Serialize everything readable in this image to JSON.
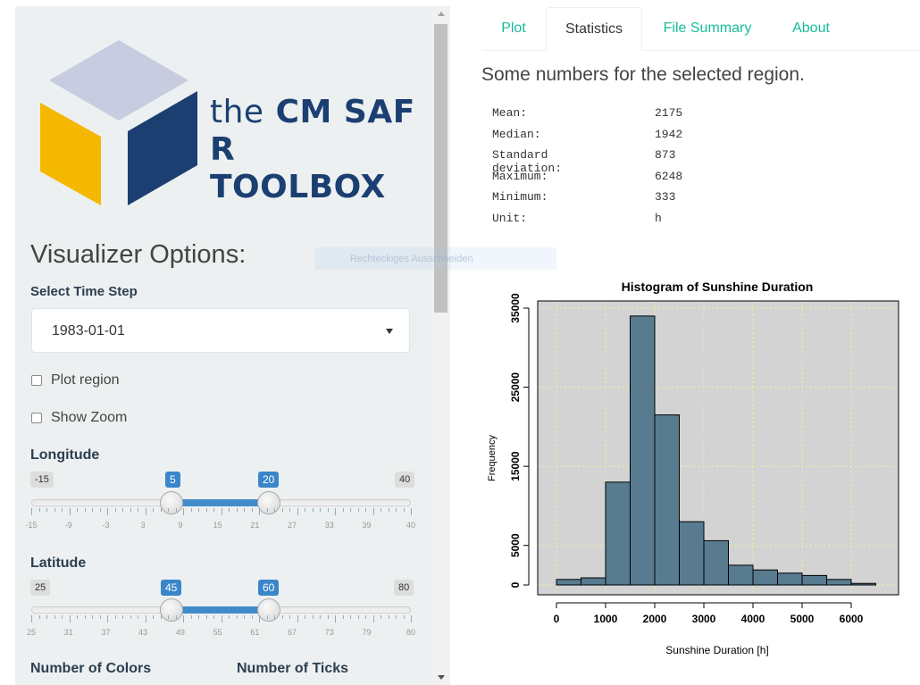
{
  "sidebar": {
    "logo": {
      "line1_thin": "the",
      "line1_bold": "CM SAF",
      "line2": "R TOOLBOX"
    },
    "title": "Visualizer Options:",
    "time_step": {
      "label": "Select Time Step",
      "value": "1983-01-01"
    },
    "checkboxes": [
      {
        "label": "Plot region",
        "checked": false
      },
      {
        "label": "Show Zoom",
        "checked": false
      }
    ],
    "longitude": {
      "label": "Longitude",
      "min": "-15",
      "max": "40",
      "from": "5",
      "to": "20",
      "tick_labels": [
        "-15",
        "-9",
        "-3",
        "3",
        "9",
        "15",
        "21",
        "27",
        "33",
        "39",
        "40"
      ]
    },
    "latitude": {
      "label": "Latitude",
      "min": "25",
      "max": "80",
      "from": "45",
      "to": "60",
      "tick_labels": [
        "25",
        "31",
        "37",
        "43",
        "49",
        "55",
        "61",
        "67",
        "73",
        "79",
        "80"
      ]
    },
    "num_colors_label": "Number of Colors",
    "num_ticks_label": "Number of Ticks"
  },
  "overlay_text": "Rechteckiges Ausschneiden",
  "tabs": [
    {
      "label": "Plot",
      "active": false
    },
    {
      "label": "Statistics",
      "active": true
    },
    {
      "label": "File Summary",
      "active": false
    },
    {
      "label": "About",
      "active": false
    }
  ],
  "statistics": {
    "heading": "Some numbers for the selected region.",
    "rows": [
      {
        "key": "Mean:",
        "value": "2175"
      },
      {
        "key": "Median:",
        "value": "1942"
      },
      {
        "key": "Standard deviation:",
        "value": "873"
      },
      {
        "key": "Maximum:",
        "value": "6248"
      },
      {
        "key": "Minimum:",
        "value": "333"
      },
      {
        "key": "Unit:",
        "value": "h"
      }
    ]
  },
  "colors": {
    "accent": "#18bc9c",
    "slider": "#428bca",
    "bar_fill": "#587b90",
    "plot_bg": "#d3d3d3",
    "logo_text": "#1c3f72"
  },
  "chart_data": {
    "type": "bar",
    "title": "Histogram of Sunshine Duration",
    "xlabel": "Sunshine Duration [h]",
    "ylabel": "Frequency",
    "bin_edges": [
      0,
      500,
      1000,
      1500,
      2000,
      2500,
      3000,
      3500,
      4000,
      4500,
      5000,
      5500,
      6000,
      6500
    ],
    "values": [
      700,
      900,
      13000,
      34000,
      21500,
      8000,
      5600,
      2500,
      1900,
      1500,
      1200,
      700,
      200
    ],
    "xlim": [
      0,
      6500
    ],
    "ylim": [
      0,
      35000
    ],
    "xticks": [
      0,
      1000,
      2000,
      3000,
      4000,
      5000,
      6000
    ],
    "yticks": [
      0,
      5000,
      15000,
      25000,
      35000
    ],
    "grid": true
  }
}
